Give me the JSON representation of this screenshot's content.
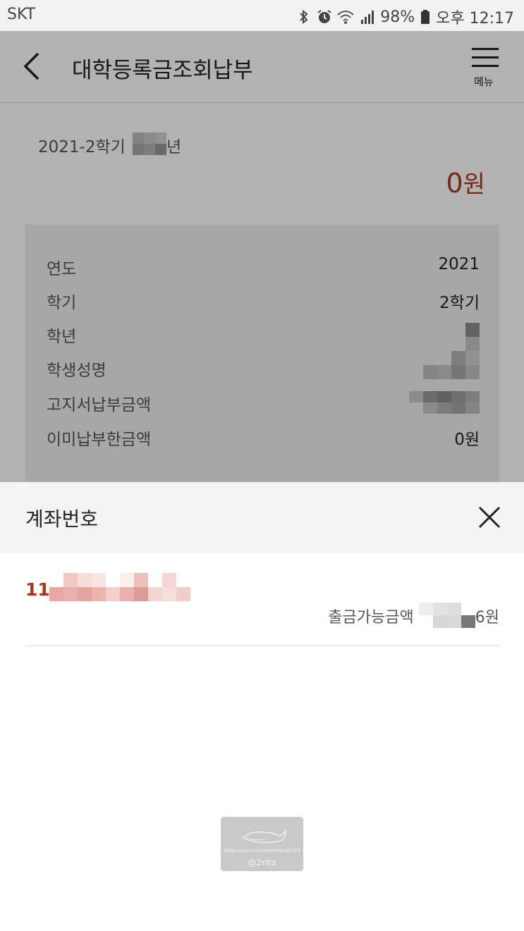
{
  "status_bar": {
    "carrier": "SKT",
    "battery": "98%",
    "time": "오후 12:17"
  },
  "header": {
    "title": "대학등록금조회납부",
    "menu_label": "메뉴"
  },
  "summary": {
    "term_label": "2021-2학기",
    "term_suffix": "년",
    "amount": "0",
    "amount_unit": "원"
  },
  "details": {
    "rows": [
      {
        "label": "연도",
        "value": "2021"
      },
      {
        "label": "학기",
        "value": "2학기"
      },
      {
        "label": "학년",
        "value": ""
      },
      {
        "label": "학생성명",
        "value": ""
      },
      {
        "label": "고지서납부금액",
        "value": ""
      },
      {
        "label": "이미납부한금액",
        "value": "0원"
      }
    ]
  },
  "sheet": {
    "title": "계좌번호",
    "account_prefix": "11",
    "available_label": "출금가능금액",
    "available_suffix": "6원"
  },
  "watermark": {
    "url": "blog.naver.com/wintersea0123",
    "handle": "@2rita"
  }
}
